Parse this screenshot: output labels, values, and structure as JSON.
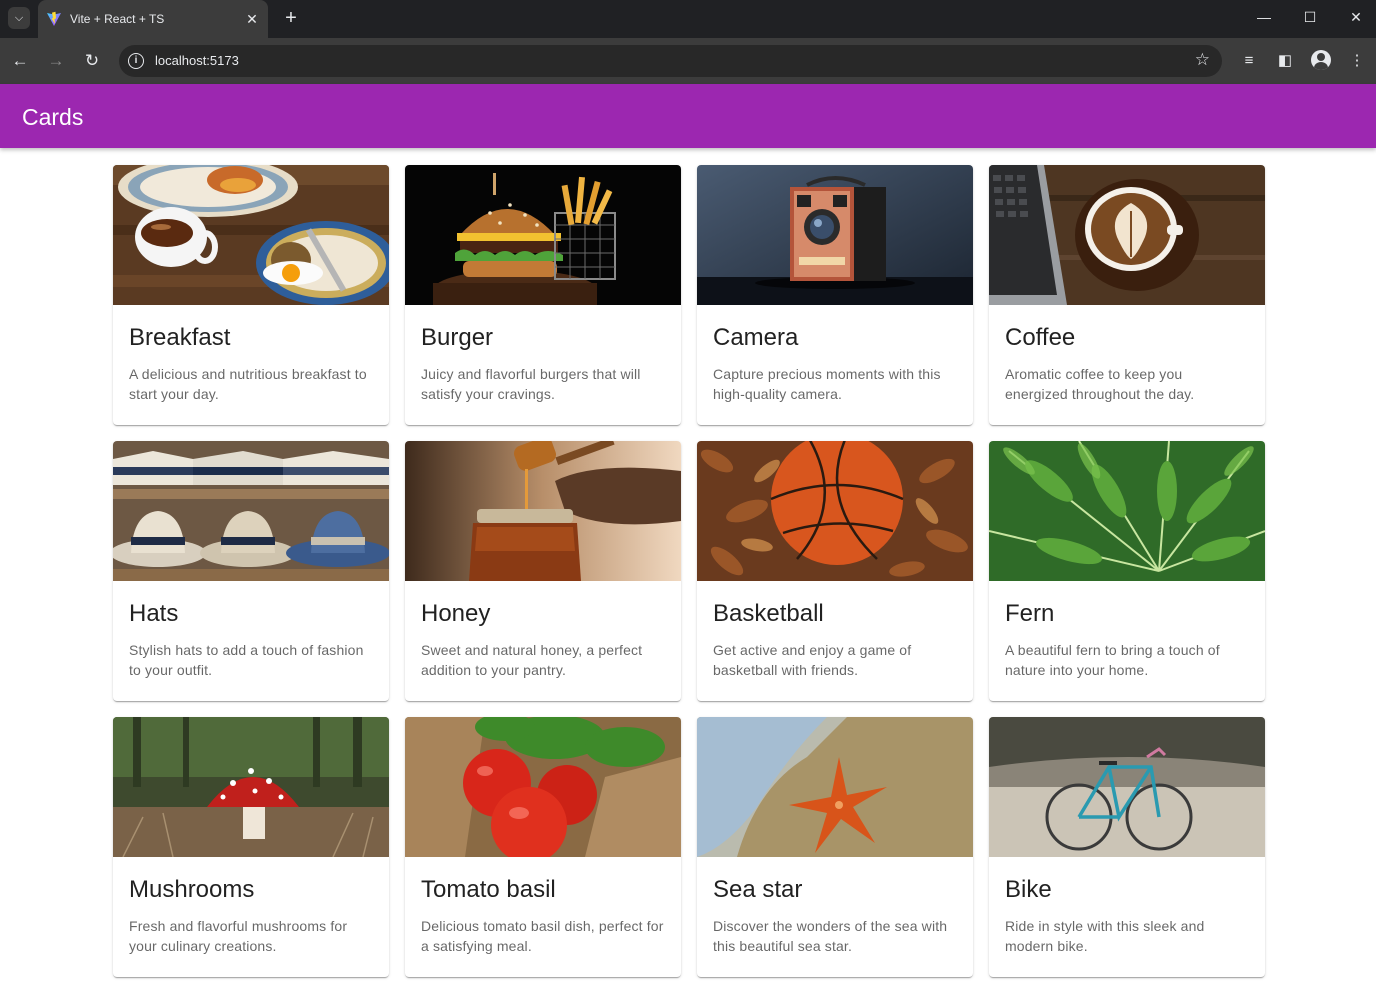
{
  "browser": {
    "tab_title": "Vite + React + TS",
    "url": "localhost:5173",
    "colors": {
      "frame": "#202124",
      "toolbar": "#3c3c3c"
    }
  },
  "app": {
    "title": "Cards",
    "accent": "#9c27b0"
  },
  "cards": [
    {
      "title": "Breakfast",
      "description": "A delicious and nutritious breakfast to start your day.",
      "image": "breakfast-photo"
    },
    {
      "title": "Burger",
      "description": "Juicy and flavorful burgers that will satisfy your cravings.",
      "image": "burger-photo"
    },
    {
      "title": "Camera",
      "description": "Capture precious moments with this high-quality camera.",
      "image": "camera-photo"
    },
    {
      "title": "Coffee",
      "description": "Aromatic coffee to keep you energized throughout the day.",
      "image": "coffee-photo"
    },
    {
      "title": "Hats",
      "description": "Stylish hats to add a touch of fashion to your outfit.",
      "image": "hats-photo"
    },
    {
      "title": "Honey",
      "description": "Sweet and natural honey, a perfect addition to your pantry.",
      "image": "honey-photo"
    },
    {
      "title": "Basketball",
      "description": "Get active and enjoy a game of basketball with friends.",
      "image": "basketball-photo"
    },
    {
      "title": "Fern",
      "description": "A beautiful fern to bring a touch of nature into your home.",
      "image": "fern-photo"
    },
    {
      "title": "Mushrooms",
      "description": "Fresh and flavorful mushrooms for your culinary creations.",
      "image": "mushrooms-photo"
    },
    {
      "title": "Tomato basil",
      "description": "Delicious tomato basil dish, perfect for a satisfying meal.",
      "image": "tomato-basil-photo"
    },
    {
      "title": "Sea star",
      "description": "Discover the wonders of the sea with this beautiful sea star.",
      "image": "sea-star-photo"
    },
    {
      "title": "Bike",
      "description": "Ride in style with this sleek and modern bike.",
      "image": "bike-photo"
    }
  ]
}
